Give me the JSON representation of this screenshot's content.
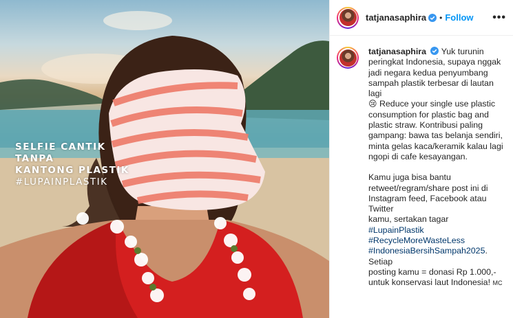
{
  "post": {
    "username": "tatjanasaphira",
    "follow_label": "Follow",
    "separator": "•",
    "more_label": "•••"
  },
  "photo": {
    "overlay_lines": [
      "SELFIE CANTIK",
      "TANPA",
      "KANTONG PLASTIK",
      "#LUPAINPLASTIK"
    ]
  },
  "caption": {
    "username": "tatjanasaphira",
    "para1_lines": [
      "Yuk turunin",
      "peringkat Indonesia, supaya nggak",
      "jadi negara kedua penyumbang",
      "sampah plastik terbesar di lautan lagi",
      "Reduce your single use plastic",
      "consumption for plastic bag and",
      "plastic straw. Kontribusi paling",
      "gampang: bawa tas belanja sendiri,",
      "minta gelas kaca/keramik kalau lagi",
      "ngopi di cafe kesayangan."
    ],
    "emoji": "😢",
    "para2_lines": [
      "Kamu juga bisa bantu",
      "retweet/regram/share post ini di",
      "Instagram feed, Facebook atau Twitter",
      "kamu, sertakan tagar"
    ],
    "hashtags": [
      "#LupainPlastik",
      "#RecycleMoreWasteLess",
      "#IndonesiaBersihSampah2025"
    ],
    "para2_end": [
      ". Setiap",
      "posting kamu = donasi Rp 1.000,-",
      "untuk konservasi laut Indonesia!"
    ],
    "signature": "MC"
  },
  "colors": {
    "follow": "#0095f6",
    "hashtag": "#00376b",
    "verified": "#3897f0"
  }
}
